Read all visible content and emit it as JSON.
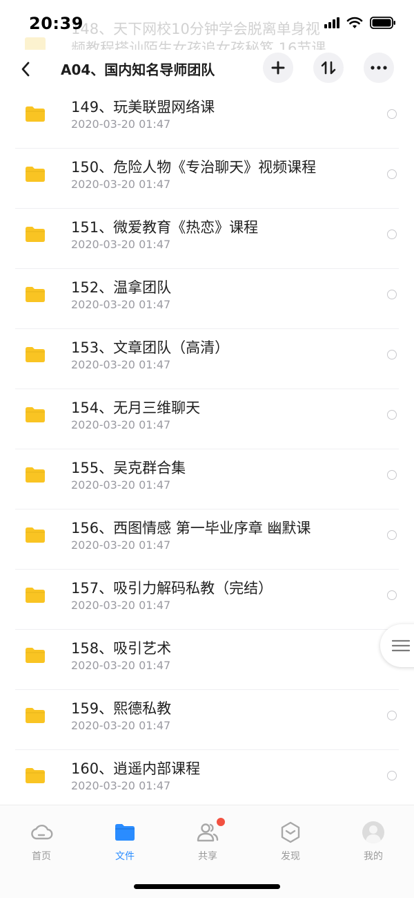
{
  "status_bar": {
    "time": "20:39"
  },
  "ghost_row": {
    "title": "148、天下网校10分钟学会脱离单身视",
    "subtitle": "频教程搭讪陌生女孩追女孩秘笈 16节课"
  },
  "nav": {
    "title": "A04、国内知名导师团队"
  },
  "files": [
    {
      "name": "149、玩美联盟网络课",
      "date": "2020-03-20 01:47"
    },
    {
      "name": "150、危险人物《专治聊天》视频课程",
      "date": "2020-03-20 01:47"
    },
    {
      "name": "151、微爱教育《热恋》课程",
      "date": "2020-03-20 01:47"
    },
    {
      "name": "152、温拿团队",
      "date": "2020-03-20 01:47"
    },
    {
      "name": "153、文章团队（高清）",
      "date": "2020-03-20 01:47"
    },
    {
      "name": "154、无月三维聊天",
      "date": "2020-03-20 01:47"
    },
    {
      "name": "155、吴克群合集",
      "date": "2020-03-20 01:47"
    },
    {
      "name": "156、西图情感 第一毕业序章 幽默课",
      "date": "2020-03-20 01:47"
    },
    {
      "name": "157、吸引力解码私教（完结）",
      "date": "2020-03-20 01:47"
    },
    {
      "name": "158、吸引艺术",
      "date": "2020-03-20 01:47"
    },
    {
      "name": "159、熙德私教",
      "date": "2020-03-20 01:47"
    },
    {
      "name": "160、逍遥内部课程",
      "date": "2020-03-20 01:47"
    }
  ],
  "tabs": {
    "home": "首页",
    "file": "文件",
    "share": "共享",
    "discover": "发现",
    "me": "我的"
  },
  "colors": {
    "folder": "#f9c423",
    "accent": "#2a8cff",
    "badge": "#f25141",
    "inactive_tab": "#9a9a9a"
  }
}
